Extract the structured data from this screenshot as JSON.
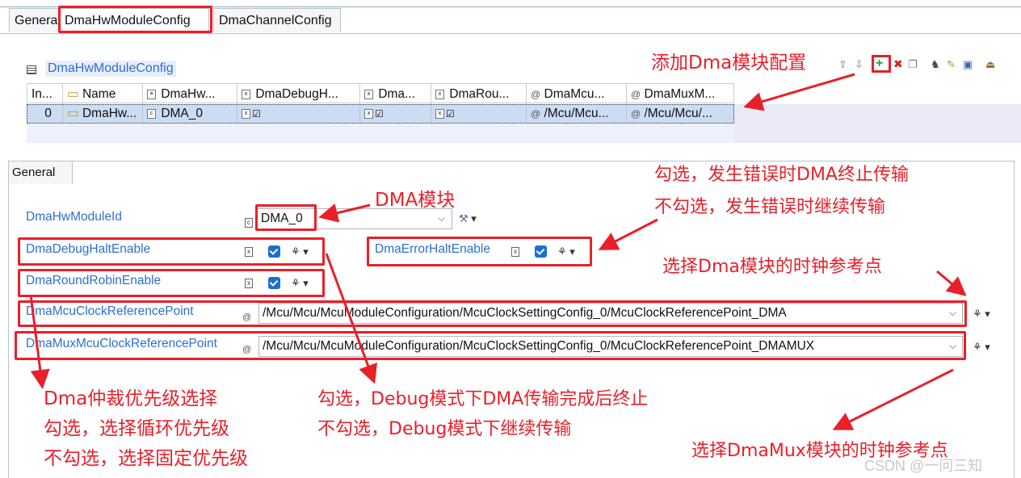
{
  "tabs": [
    "General",
    "DmaHwModuleConfig",
    "DmaChannelConfig"
  ],
  "section_title": "DmaHwModuleConfig",
  "table": {
    "headers": [
      "In...",
      "Name",
      "DmaHw...",
      "DmaDebugH...",
      "Dma...",
      "DmaRou...",
      "DmaMcu...",
      "DmaMuxM..."
    ],
    "row": {
      "index": "0",
      "name": "DmaHw...",
      "module_id": "DMA_0",
      "mcu_ref": "/Mcu/Mcu...",
      "mux_ref": "/Mcu/Mcu/..."
    }
  },
  "general_tab": "General",
  "form": {
    "module_id_label": "DmaHwModuleId",
    "module_id_value": "DMA_0",
    "debug_halt_label": "DmaDebugHaltEnable",
    "error_halt_label": "DmaErrorHaltEnable",
    "round_robin_label": "DmaRoundRobinEnable",
    "mcu_clock_label": "DmaMcuClockReferencePoint",
    "mcu_clock_value": "/Mcu/Mcu/McuModuleConfiguration/McuClockSettingConfig_0/McuClockReferencePoint_DMA",
    "mux_clock_label": "DmaMuxMcuClockReferencePoint",
    "mux_clock_value": "/Mcu/Mcu/McuModuleConfiguration/McuClockSettingConfig_0/McuClockReferencePoint_DMAMUX",
    "debug_halt_checked": true,
    "error_halt_checked": true,
    "round_robin_checked": true
  },
  "annotations": {
    "add_module": "添加Dma模块配置",
    "error_halt_1": "勾选，发生错误时DMA终止传输",
    "error_halt_2": "不勾选，发生错误时继续传输",
    "dma_module": "DMA模块",
    "clock_ref": "选择Dma模块的时钟参考点",
    "round_robin_1": "Dma仲裁优先级选择",
    "round_robin_2": "勾选，选择循环优先级",
    "round_robin_3": "不勾选，选择固定优先级",
    "debug_halt_1": "勾选，Debug模式下DMA传输完成后终止",
    "debug_halt_2": "不勾选，Debug模式下继续传输",
    "mux_clock_ref": "选择DmaMux模块的时钟参考点"
  },
  "watermark": "CSDN @一问三知",
  "colors": {
    "annotation_red": "#e8202a",
    "label_blue": "#2d6fd1",
    "checkbox_blue": "#1d6ed4",
    "row_selected": "#cbdcf3"
  }
}
